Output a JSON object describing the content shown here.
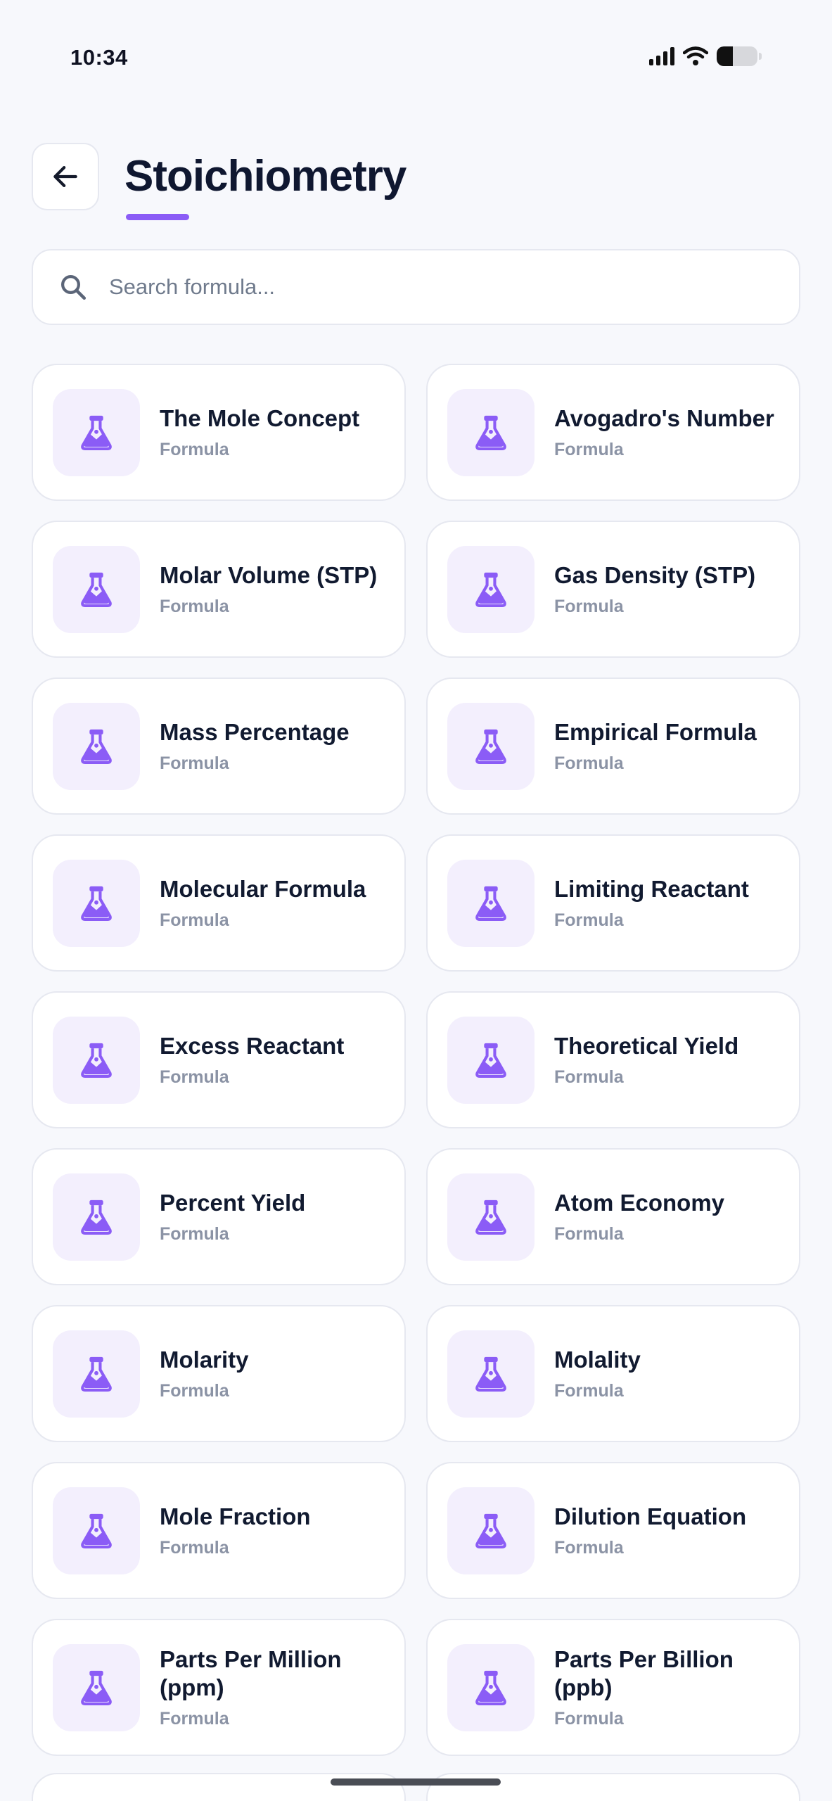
{
  "status_bar": {
    "time": "10:34"
  },
  "header": {
    "back_icon": "arrow-left-icon",
    "title": "Stoichiometry"
  },
  "search": {
    "placeholder": "Search formula...",
    "value": ""
  },
  "colors": {
    "accent": "#8b5cf6",
    "icon_bg": "#f3effd",
    "background": "#f7f8fc"
  },
  "formulas": [
    {
      "title": "The Mole Concept",
      "subtitle": "Formula",
      "icon": "flask-icon"
    },
    {
      "title": "Avogadro's Number",
      "subtitle": "Formula",
      "icon": "flask-icon"
    },
    {
      "title": "Molar Volume (STP)",
      "subtitle": "Formula",
      "icon": "flask-icon"
    },
    {
      "title": "Gas Density (STP)",
      "subtitle": "Formula",
      "icon": "flask-icon"
    },
    {
      "title": "Mass Percentage",
      "subtitle": "Formula",
      "icon": "flask-icon"
    },
    {
      "title": "Empirical Formula",
      "subtitle": "Formula",
      "icon": "flask-icon"
    },
    {
      "title": "Molecular Formula",
      "subtitle": "Formula",
      "icon": "flask-icon"
    },
    {
      "title": "Limiting Reactant",
      "subtitle": "Formula",
      "icon": "flask-icon"
    },
    {
      "title": "Excess Reactant",
      "subtitle": "Formula",
      "icon": "flask-icon"
    },
    {
      "title": "Theoretical Yield",
      "subtitle": "Formula",
      "icon": "flask-icon"
    },
    {
      "title": "Percent Yield",
      "subtitle": "Formula",
      "icon": "flask-icon"
    },
    {
      "title": "Atom Economy",
      "subtitle": "Formula",
      "icon": "flask-icon"
    },
    {
      "title": "Molarity",
      "subtitle": "Formula",
      "icon": "flask-icon"
    },
    {
      "title": "Molality",
      "subtitle": "Formula",
      "icon": "flask-icon"
    },
    {
      "title": "Mole Fraction",
      "subtitle": "Formula",
      "icon": "flask-icon"
    },
    {
      "title": "Dilution Equation",
      "subtitle": "Formula",
      "icon": "flask-icon"
    },
    {
      "title": "Parts Per Million (ppm)",
      "subtitle": "Formula",
      "icon": "flask-icon"
    },
    {
      "title": "Parts Per Billion (ppb)",
      "subtitle": "Formula",
      "icon": "flask-icon"
    }
  ]
}
